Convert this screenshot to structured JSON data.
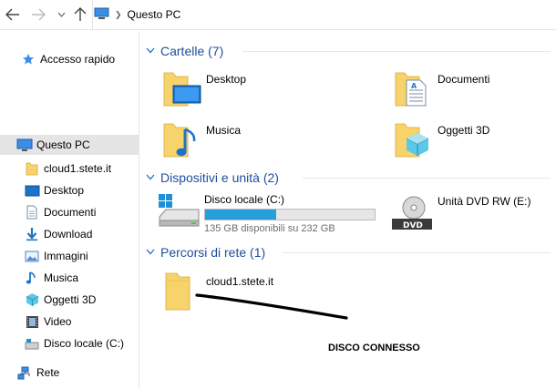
{
  "address_bar": {
    "location": "Questo PC",
    "icon": "pc-icon"
  },
  "sidebar": {
    "items": [
      {
        "label": "Accesso rapido",
        "icon": "star-icon"
      },
      {
        "label": "Questo PC",
        "icon": "pc-icon",
        "selected": true
      },
      {
        "label": "cloud1.stete.it",
        "icon": "folder-icon"
      },
      {
        "label": "Desktop",
        "icon": "desktop-icon"
      },
      {
        "label": "Documenti",
        "icon": "documents-icon"
      },
      {
        "label": "Download",
        "icon": "download-icon"
      },
      {
        "label": "Immagini",
        "icon": "pictures-icon"
      },
      {
        "label": "Musica",
        "icon": "music-icon"
      },
      {
        "label": "Oggetti 3D",
        "icon": "cube-3d-icon"
      },
      {
        "label": "Video",
        "icon": "video-icon"
      },
      {
        "label": "Disco locale (C:)",
        "icon": "drive-icon"
      },
      {
        "label": "Rete",
        "icon": "network-icon"
      }
    ]
  },
  "groups": {
    "folders": {
      "title": "Cartelle (7)",
      "items": [
        {
          "label": "Desktop",
          "icon": "desktop-folder-icon"
        },
        {
          "label": "Documenti",
          "icon": "documents-folder-icon"
        },
        {
          "label": "Musica",
          "icon": "music-folder-icon"
        },
        {
          "label": "Oggetti 3D",
          "icon": "3d-objects-folder-icon"
        }
      ]
    },
    "devices": {
      "title": "Dispositivi e unità (2)",
      "local_disk": {
        "label": "Disco locale (C:)",
        "free_text": "135 GB disponibili su 232 GB",
        "used_fraction": 0.418
      },
      "dvd": {
        "label": "Unità DVD RW (E:)",
        "badge": "DVD"
      }
    },
    "network": {
      "title": "Percorsi di rete (1)",
      "items": [
        {
          "label": "cloud1.stete.it",
          "icon": "network-folder-icon"
        }
      ]
    }
  },
  "annotation": {
    "text": "DISCO CONNESSO"
  },
  "colors": {
    "group_title": "#1e4e9c",
    "accent": "#26a0da",
    "folder": "#f7d36b"
  }
}
